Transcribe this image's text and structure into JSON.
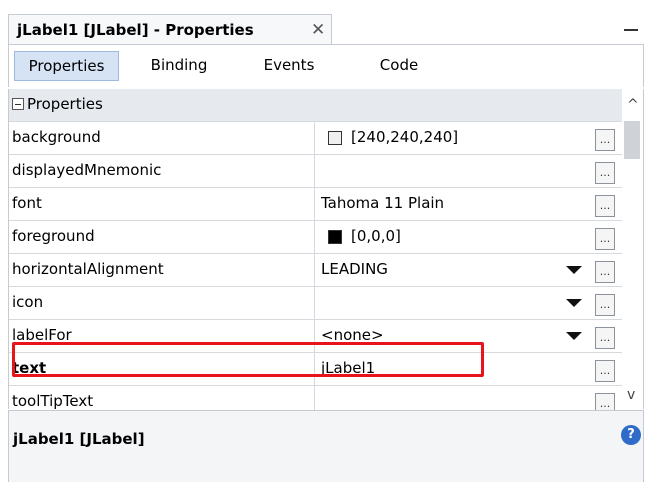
{
  "panel": {
    "title": "jLabel1 [JLabel] - Properties",
    "close_glyph": "✕",
    "minimize_icon": "minimize-icon"
  },
  "subtabs": [
    "Properties",
    "Binding",
    "Events",
    "Code"
  ],
  "active_subtab": "Properties",
  "category": {
    "label": "Properties",
    "state": "expanded"
  },
  "properties": [
    {
      "name": "background",
      "value": "[240,240,240]",
      "swatch": "#f0f0f0"
    },
    {
      "name": "displayedMnemonic",
      "value": ""
    },
    {
      "name": "font",
      "value": "Tahoma 11 Plain"
    },
    {
      "name": "foreground",
      "value": "[0,0,0]",
      "swatch": "#000000"
    },
    {
      "name": "horizontalAlignment",
      "value": "LEADING",
      "dropdown": true
    },
    {
      "name": "icon",
      "value": "",
      "dropdown": true
    },
    {
      "name": "labelFor",
      "value": "<none>",
      "dropdown": true
    },
    {
      "name": "text",
      "value": "jLabel1",
      "bold": true,
      "highlighted": true
    },
    {
      "name": "toolTipText",
      "value": ""
    }
  ],
  "ellipsis_label": "...",
  "description": {
    "title": "jLabel1 [JLabel]",
    "help_glyph": "?"
  },
  "scrollbar": {
    "up": "^",
    "down": "v"
  }
}
